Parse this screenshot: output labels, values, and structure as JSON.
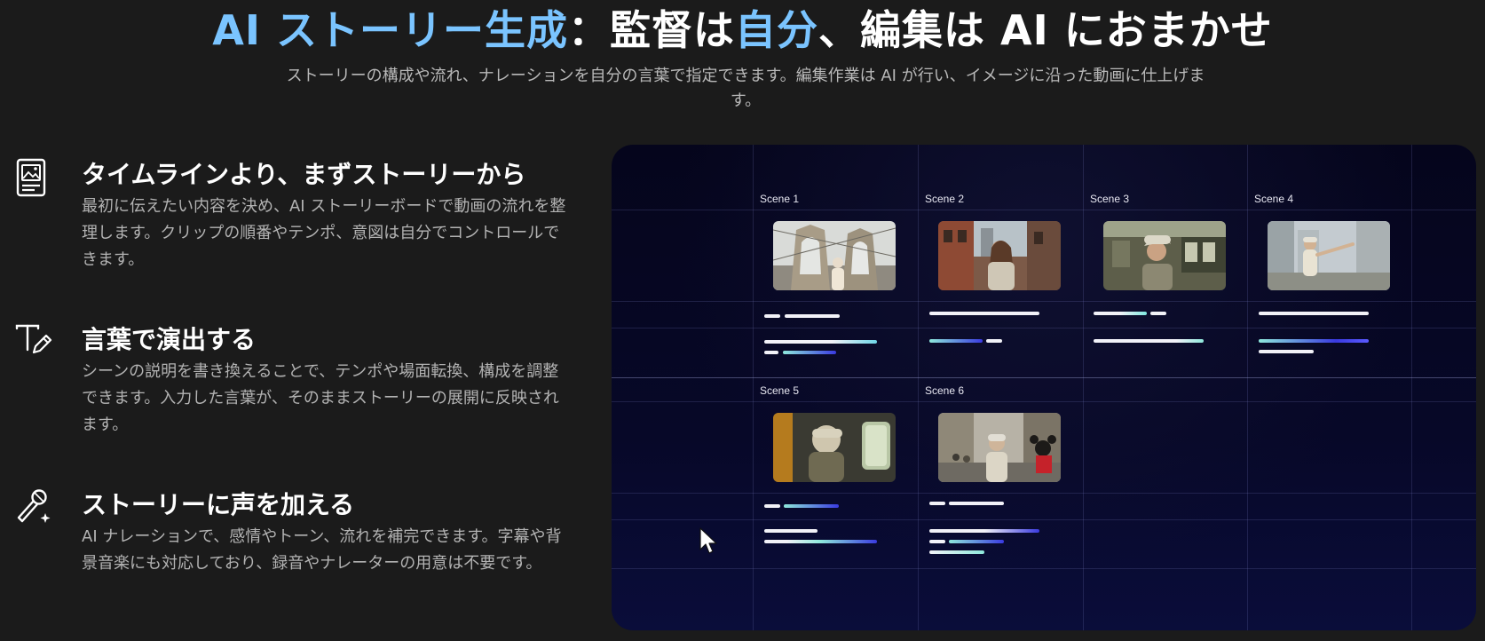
{
  "header": {
    "title_part1": "AI ストーリー生成",
    "title_part2": "：監督は",
    "title_part3": "自分",
    "title_part4": "、編集は AI におまかせ",
    "subtitle": "ストーリーの構成や流れ、ナレーションを自分の言葉で指定できます。編集作業は AI が行い、イメージに沿った動画に仕上げます。"
  },
  "features": [
    {
      "icon": "storyboard-icon",
      "title": "タイムラインより、まずストーリーから",
      "desc": "最初に伝えたい内容を決め、AI ストーリーボードで動画の流れを整理します。クリップの順番やテンポ、意図は自分でコントロールできます。"
    },
    {
      "icon": "text-edit-icon",
      "title": "言葉で演出する",
      "desc": "シーンの説明を書き換えることで、テンポや場面転換、構成を調整できます。入力した言葉が、そのままストーリーの展開に反映されます。"
    },
    {
      "icon": "microphone-sparkle-icon",
      "title": "ストーリーに声を加える",
      "desc": "AI ナレーションで、感情やトーン、流れを補完できます。字幕や背景音楽にも対応しており、録音やナレーターの用意は不要です。"
    }
  ],
  "storyboard": {
    "scenes": [
      {
        "label": "Scene 1"
      },
      {
        "label": "Scene 2"
      },
      {
        "label": "Scene 3"
      },
      {
        "label": "Scene 4"
      },
      {
        "label": "Scene 5"
      },
      {
        "label": "Scene 6"
      }
    ]
  },
  "colors": {
    "accent": "#7ac4ff",
    "background": "#1b1b1b",
    "panel": "#05051c",
    "bar_teal": "#7fe8e0",
    "bar_blue": "#3a3ae0"
  }
}
